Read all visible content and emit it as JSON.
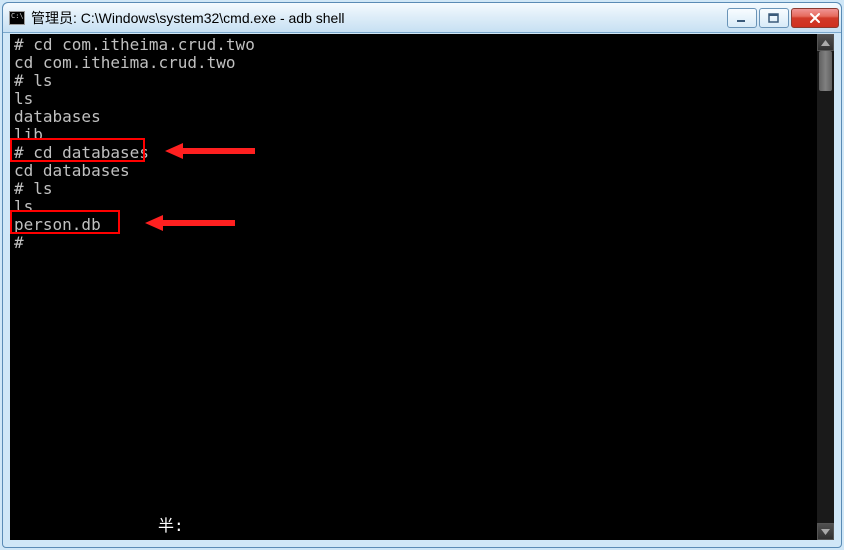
{
  "window": {
    "title": "管理员: C:\\Windows\\system32\\cmd.exe - adb  shell"
  },
  "terminal": {
    "lines": [
      "# cd com.itheima.crud.two",
      "cd com.itheima.crud.two",
      "# ls",
      "ls",
      "databases",
      "lib",
      "# cd databases",
      "cd databases",
      "# ls",
      "ls",
      "person.db",
      "#"
    ]
  },
  "annotations": {
    "highlight1_label": "cd-databases-highlight",
    "highlight2_label": "person-db-highlight",
    "arrow1_label": "arrow-to-cd-databases",
    "arrow2_label": "arrow-to-person-db"
  },
  "ime": {
    "status": "半:"
  }
}
